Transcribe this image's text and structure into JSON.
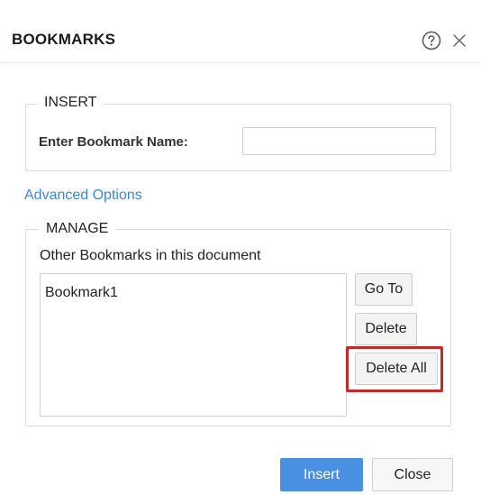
{
  "dialog": {
    "title": "BOOKMARKS",
    "help_icon": "help-circle-icon",
    "close_icon": "close-icon"
  },
  "insert": {
    "legend": "INSERT",
    "name_label": "Enter Bookmark Name:",
    "name_value": "",
    "name_placeholder": ""
  },
  "advanced_options_label": "Advanced Options",
  "manage": {
    "legend": "MANAGE",
    "caption": "Other Bookmarks in this document",
    "bookmarks": [
      "Bookmark1"
    ],
    "goto_label": "Go To",
    "delete_label": "Delete",
    "delete_all_label": "Delete All"
  },
  "footer": {
    "insert_label": "Insert",
    "close_label": "Close"
  },
  "colors": {
    "accent": "#4a90e2",
    "link": "#3a86d4",
    "highlight": "#c62828"
  }
}
